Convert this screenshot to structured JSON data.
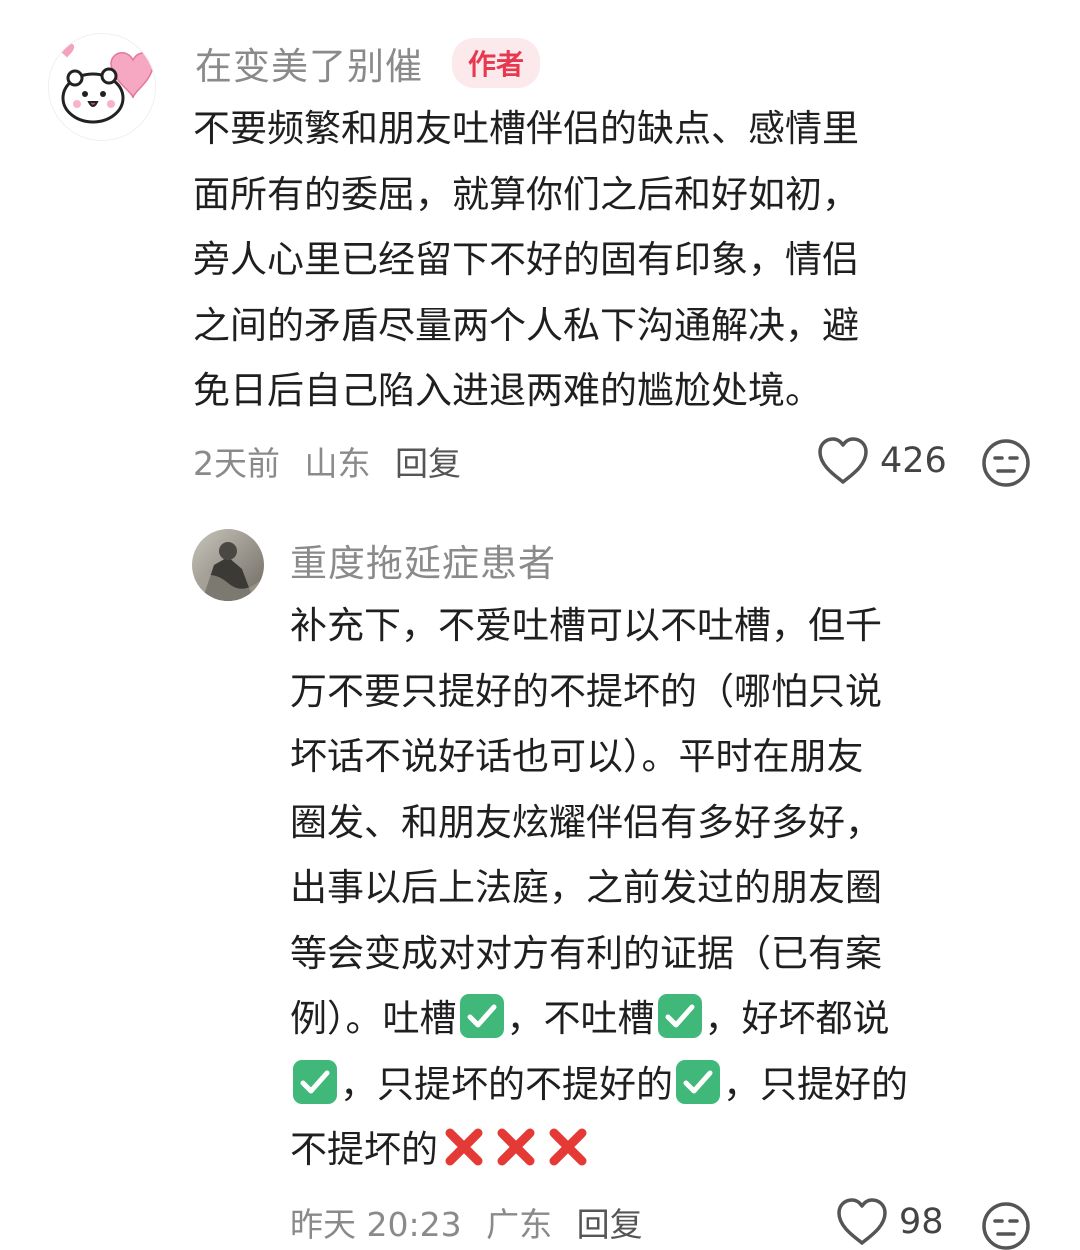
{
  "main_comment": {
    "username": "在变美了别催",
    "badge": "作者",
    "lines": [
      "不要频繁和朋友吐槽伴侣的缺点、感情里",
      "面所有的委屈，就算你们之后和好如初，",
      "旁人心里已经留下不好的固有印象，情侣",
      "之间的矛盾尽量两个人私下沟通解决，避",
      "免日后自己陷入进退两难的尴尬处境。"
    ],
    "time": "2天前",
    "location": "山东",
    "reply_label": "回复",
    "likes": "426"
  },
  "reply_comment": {
    "username": "重度拖延症患者",
    "lines": [
      "补充下，不爱吐槽可以不吐槽，但千",
      "万不要只提好的不提坏的（哪怕只说",
      "坏话不说好话也可以）。平时在朋友",
      "圈发、和朋友炫耀伴侣有多好多好，",
      "出事以后上法庭，之前发过的朋友圈",
      "等会变成对对方有利的证据（已有案"
    ],
    "line7": {
      "a": "例）。吐槽",
      "b": "，不吐槽",
      "c": "，好坏都说"
    },
    "line8": {
      "a": "，只提坏的不提好的",
      "b": "，只提好的"
    },
    "line9": {
      "a": "不提坏的"
    },
    "time": "昨天 20:23",
    "location": "广东",
    "reply_label": "回复",
    "likes": "98"
  },
  "icons": {
    "like": "heart-outline-icon",
    "dislike": "neutral-face-icon",
    "check": "check-mark-button-emoji",
    "cross": "cross-mark-emoji"
  },
  "colors": {
    "badge_bg": "#fbe9ec",
    "badge_text": "#e8384f",
    "meta_text": "#8a8a8a",
    "check_green": "#3fb87a",
    "cross_red": "#e53935"
  }
}
